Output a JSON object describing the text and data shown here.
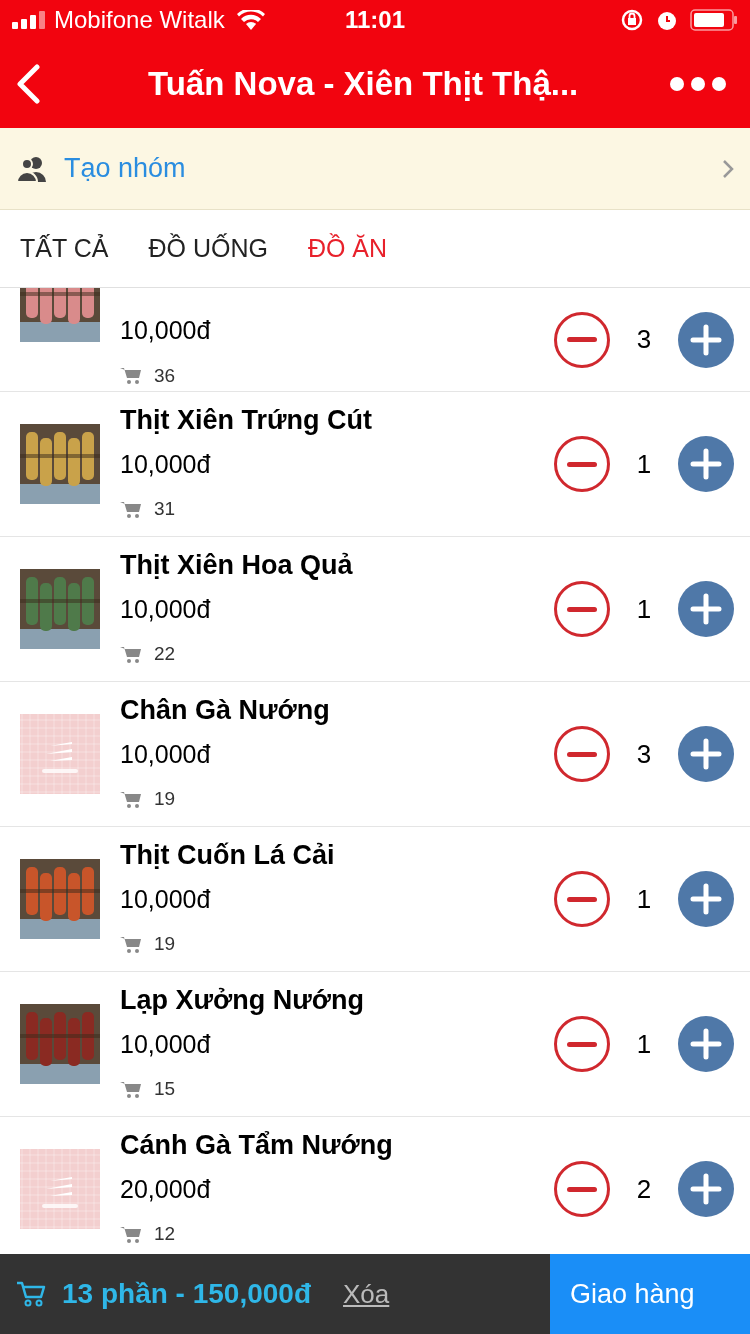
{
  "status_bar": {
    "carrier": "Mobifone Witalk",
    "time": "11:01"
  },
  "header": {
    "title": "Tuấn Nova - Xiên Thịt Thậ..."
  },
  "group_bar": {
    "label": "Tạo nhóm"
  },
  "tabs": [
    {
      "label": "TẤT CẢ",
      "selected": false
    },
    {
      "label": "ĐỒ UỐNG",
      "selected": false
    },
    {
      "label": "ĐỒ ĂN",
      "selected": true
    }
  ],
  "items": [
    {
      "price": "10,000đ",
      "sold": "36",
      "quantity": "3"
    },
    {
      "name": "Thịt Xiên Trứng Cút",
      "price": "10,000đ",
      "sold": "31",
      "quantity": "1"
    },
    {
      "name": "Thịt Xiên Hoa Quả",
      "price": "10,000đ",
      "sold": "22",
      "quantity": "1"
    },
    {
      "name": "Chân Gà Nướng",
      "price": "10,000đ",
      "sold": "19",
      "quantity": "3",
      "kind": "placeholder"
    },
    {
      "name": "Thịt Cuốn Lá Cải",
      "price": "10,000đ",
      "sold": "19",
      "quantity": "1"
    },
    {
      "name": "Lạp Xưởng Nướng",
      "price": "10,000đ",
      "sold": "15",
      "quantity": "1"
    },
    {
      "name": "Cánh Gà Tẩm Nướng",
      "price": "20,000đ",
      "sold": "12",
      "quantity": "2",
      "kind": "placeholder"
    }
  ],
  "cart_bar": {
    "summary": "13 phần - 150,000đ",
    "clear": "Xóa",
    "checkout": "Giao hàng"
  }
}
